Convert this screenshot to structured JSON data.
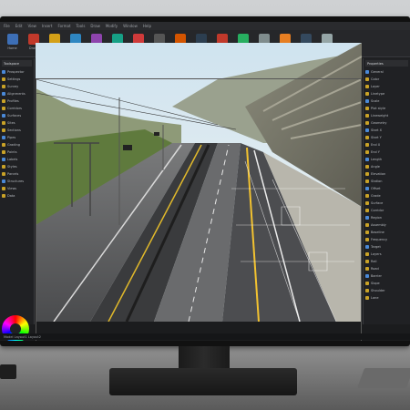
{
  "menubar": {
    "items": [
      "File",
      "Edit",
      "View",
      "Insert",
      "Format",
      "Tools",
      "Draw",
      "Modify",
      "Window",
      "Help"
    ]
  },
  "ribbon": {
    "tools": [
      {
        "label": "Home",
        "icon": "home-icon",
        "color": "#3d6fb6"
      },
      {
        "label": "Draw",
        "icon": "pencil-icon",
        "color": "#c0392b"
      },
      {
        "label": "Modify",
        "icon": "arrow-icon",
        "color": "#d4a017"
      },
      {
        "label": "Layers",
        "icon": "layers-icon",
        "color": "#2e86c1"
      },
      {
        "label": "Annotate",
        "icon": "text-icon",
        "color": "#8e44ad"
      },
      {
        "label": "Insert",
        "icon": "block-icon",
        "color": "#16a085"
      },
      {
        "label": "Survey",
        "icon": "target-icon",
        "color": "#cf3a3a"
      },
      {
        "label": "Alignment",
        "icon": "road-icon",
        "color": "#555"
      },
      {
        "label": "Profile",
        "icon": "profile-icon",
        "color": "#d35400"
      },
      {
        "label": "Corridor",
        "icon": "corridor-icon",
        "color": "#2c3e50"
      },
      {
        "label": "Sections",
        "icon": "section-icon",
        "color": "#c0392b"
      },
      {
        "label": "Grading",
        "icon": "grade-icon",
        "color": "#27ae60"
      },
      {
        "label": "View",
        "icon": "eye-icon",
        "color": "#7f8c8d"
      },
      {
        "label": "Render",
        "icon": "render-icon",
        "color": "#e67e22"
      },
      {
        "label": "Output",
        "icon": "print-icon",
        "color": "#34495e"
      },
      {
        "label": "Settings",
        "icon": "gear-icon",
        "color": "#95a5a6"
      }
    ]
  },
  "left_panel": {
    "heading": "Toolspace",
    "items": [
      "Prospector",
      "Settings",
      "Survey",
      "Alignments",
      "Profiles",
      "Corridors",
      "Surfaces",
      "Sites",
      "Sections",
      "Pipes",
      "Grading",
      "Points",
      "Labels",
      "Styles",
      "Parcels",
      "Structures",
      "Views",
      "Data"
    ]
  },
  "right_panel": {
    "heading": "Properties",
    "items": [
      "General",
      "Color",
      "Layer",
      "Linetype",
      "Scale",
      "Plot style",
      "Lineweight",
      "Geometry",
      "Start X",
      "Start Y",
      "End X",
      "End Y",
      "Length",
      "Angle",
      "Elevation",
      "Station",
      "Offset",
      "Grade",
      "Surface",
      "Corridor",
      "Region",
      "Assembly",
      "Baseline",
      "Frequency",
      "Target",
      "Layers",
      "Rail",
      "Road",
      "Barrier",
      "Slope",
      "Shoulder",
      "Lane"
    ]
  },
  "status": {
    "text": "Model  Layout1  Layout2"
  },
  "colors": {
    "accent": "#c9a227",
    "panel": "#202124",
    "ribbon": "#26272a"
  }
}
